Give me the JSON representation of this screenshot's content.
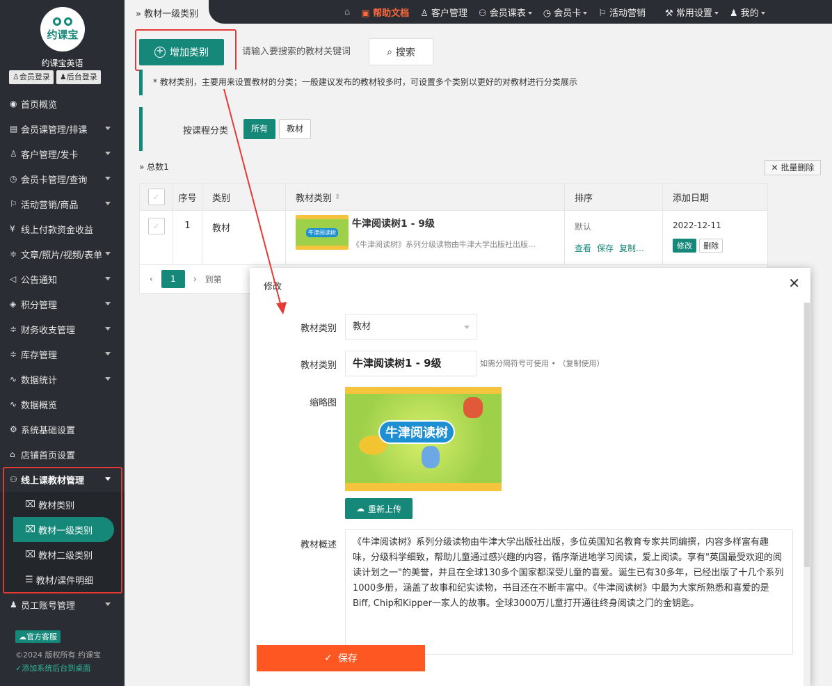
{
  "sidebar": {
    "logo_text": "约课宝",
    "brand": "约课宝英语",
    "login_member": "会员登录",
    "login_admin": "后台登录",
    "menu": [
      {
        "icon": "◉",
        "label": "首页概览",
        "caret": false
      },
      {
        "icon": "▤",
        "label": "会员课管理/排课",
        "caret": true
      },
      {
        "icon": "♙",
        "label": "客户管理/发卡",
        "caret": true
      },
      {
        "icon": "◷",
        "label": "会员卡管理/查询",
        "caret": true
      },
      {
        "icon": "⚐",
        "label": "活动营销/商品",
        "caret": true
      },
      {
        "icon": "¥",
        "label": "线上付款资金收益",
        "caret": false
      },
      {
        "icon": "≑",
        "label": "文章/照片/视频/表单",
        "caret": true
      },
      {
        "icon": "◁",
        "label": "公告通知",
        "caret": true
      },
      {
        "icon": "◈",
        "label": "积分管理",
        "caret": true
      },
      {
        "icon": "≑",
        "label": "财务收支管理",
        "caret": true
      },
      {
        "icon": "≑",
        "label": "库存管理",
        "caret": true
      },
      {
        "icon": "∿",
        "label": "数据统计",
        "caret": true
      },
      {
        "icon": "∿",
        "label": "数据概览",
        "caret": false
      },
      {
        "icon": "⚙",
        "label": "系统基础设置",
        "caret": false
      },
      {
        "icon": "⌂",
        "label": "店铺首页设置",
        "caret": false
      }
    ],
    "open_menu": "线上课教材管理",
    "submenu": [
      "教材类别",
      "教材一级类别",
      "教材二级类别",
      "教材/课件明细"
    ],
    "after_menu": "员工账号管理",
    "service": "官方客服",
    "copyright": "©2024 版权所有 约课宝",
    "add_desktop": "添加系统后台到桌面"
  },
  "topbar": {
    "breadcrumb": "教材一级类别",
    "help": "帮助文档",
    "customer": "客户管理",
    "schedule": "会员课表",
    "card": "会员卡",
    "marketing": "活动营销",
    "settings": "常用设置",
    "mine": "我的"
  },
  "main": {
    "add_label": "增加类别",
    "search_placeholder": "请输入要搜索的教材关键词",
    "search_label": "搜索",
    "notice": "* 教材类别，主要用来设置教材的分类；一般建议发布的教材较多时，可设置多个类别以更好的对教材进行分类展示",
    "filter_label": "按课程分类",
    "filter_all": "所有",
    "filter_material": "教材",
    "total": "总数1",
    "batch_delete": "批量删除",
    "columns": [
      "序号",
      "类别",
      "教材类别",
      "排序",
      "添加日期"
    ],
    "row": {
      "index": "1",
      "type": "教材",
      "thumb_text": "牛津阅读树",
      "name": "牛津阅读树1 - 9级",
      "desc": "《牛津阅读树》系列分级读物由牛津大学出版社出版…",
      "sort": "默认",
      "view": "查看",
      "save": "保存",
      "copy": "复制…",
      "date": "2022-12-11",
      "edit": "修改",
      "delete": "删除"
    },
    "page": "1",
    "goto": "到第"
  },
  "modal": {
    "title": "修改",
    "type_label": "教材类别",
    "type_value": "教材",
    "name_label": "教材类别",
    "name_value": "牛津阅读树1 - 9级",
    "hint": "如需分隔符号可使用 • （复制使用）",
    "thumb_label": "缩略图",
    "image_text": "牛津阅读树",
    "reupload": "重新上传",
    "desc_label": "教材概述",
    "desc": "《牛津阅读树》系列分级读物由牛津大学出版社出版，多位英国知名教育专家共同编撰，内容多样富有趣味，分级科学细致，帮助儿童通过感兴趣的内容，循序渐进地学习阅读，爱上阅读。享有\"英国最受欢迎的阅读计划之一\"的美誉，并且在全球130多个国家都深受儿童的喜爱。诞生已有30多年，已经出版了十几个系列1000多册，涵盖了故事和纪实读物，书目还在不断丰富中。《牛津阅读树》中最为大家所熟悉和喜爱的是Biff, Chip和Kipper一家人的故事。全球3000万儿童打开通往终身阅读之门的金钥匙。",
    "save": "保存"
  },
  "colors": {
    "accent": "#16887a",
    "highlight": "#e53935",
    "save": "#ff5722",
    "sidebar": "#2a2d33"
  }
}
